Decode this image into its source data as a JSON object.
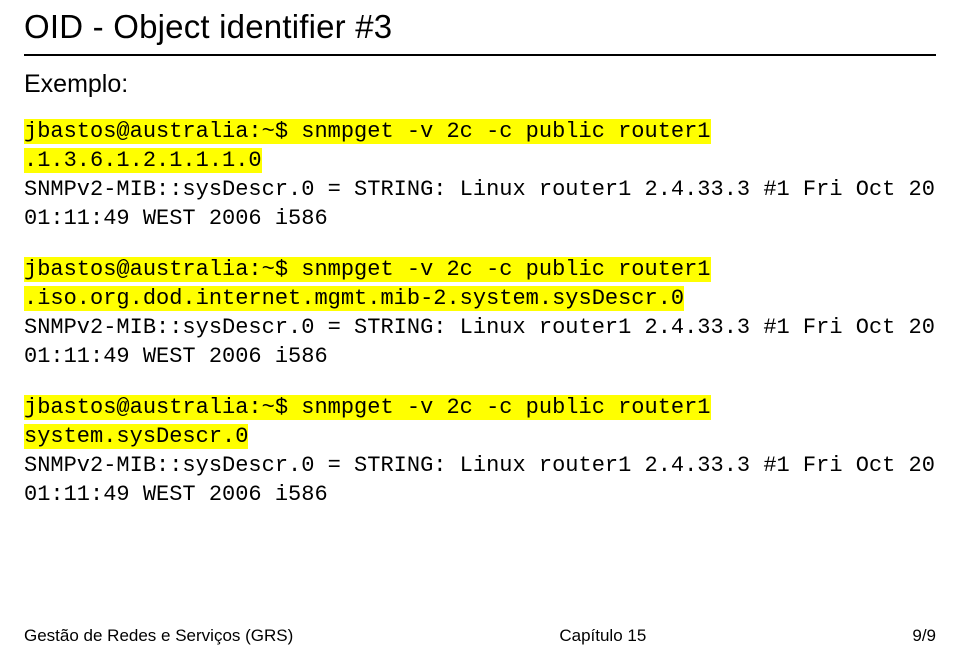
{
  "title": "OID - Object identifier #3",
  "section_label": "Exemplo:",
  "examples": [
    {
      "cmd": "jbastos@australia:~$ snmpget -v 2c -c public router1 .1.3.6.1.2.1.1.1.0",
      "resp": "SNMPv2-MIB::sysDescr.0 = STRING: Linux router1 2.4.33.3 #1 Fri Oct 20 01:11:49 WEST 2006 i586"
    },
    {
      "cmd": "jbastos@australia:~$ snmpget -v 2c -c public router1 .iso.org.dod.internet.mgmt.mib-2.system.sysDescr.0",
      "resp": "SNMPv2-MIB::sysDescr.0 = STRING: Linux router1 2.4.33.3 #1 Fri Oct 20 01:11:49 WEST 2006 i586"
    },
    {
      "cmd": "jbastos@australia:~$  snmpget -v 2c -c public router1 system.sysDescr.0",
      "resp": "SNMPv2-MIB::sysDescr.0 = STRING: Linux router1 2.4.33.3 #1 Fri Oct 20 01:11:49 WEST 2006 i586"
    }
  ],
  "footer": {
    "left": "Gestão de Redes e Serviços (GRS)",
    "center": "Capítulo 15",
    "right": "9/9"
  }
}
